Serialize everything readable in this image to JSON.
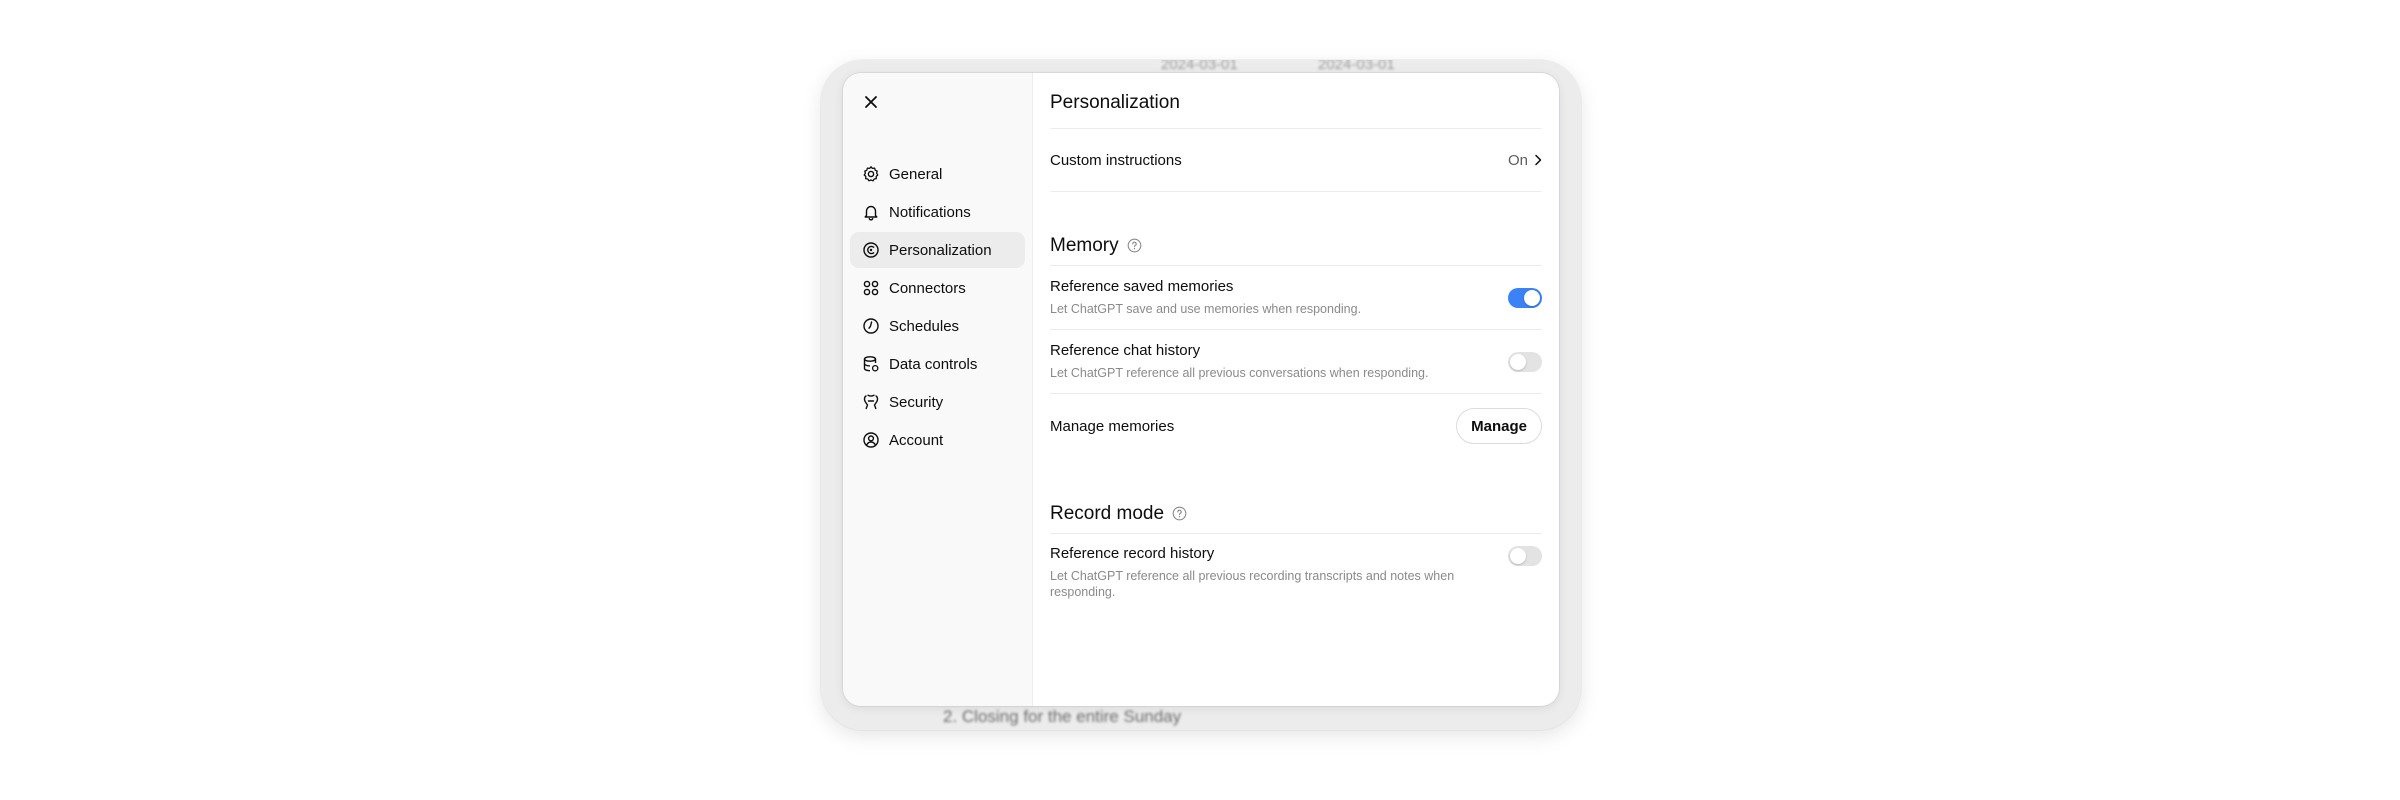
{
  "background": {
    "fragments": [
      "2024-03-01",
      "2024-03-01"
    ],
    "list_item": "2.  Closing for the entire Sunday"
  },
  "dialog": {
    "close_icon": "close-icon",
    "sidebar": {
      "items": [
        {
          "label": "General",
          "icon": "gear-icon"
        },
        {
          "label": "Notifications",
          "icon": "bell-icon"
        },
        {
          "label": "Personalization",
          "icon": "personalization-icon",
          "active": true
        },
        {
          "label": "Connectors",
          "icon": "connectors-icon"
        },
        {
          "label": "Schedules",
          "icon": "clock-icon"
        },
        {
          "label": "Data controls",
          "icon": "database-icon"
        },
        {
          "label": "Security",
          "icon": "shield-icon"
        },
        {
          "label": "Account",
          "icon": "user-circle-icon"
        }
      ]
    },
    "content": {
      "title": "Personalization",
      "custom_instructions": {
        "label": "Custom instructions",
        "value": "On"
      },
      "memory": {
        "title": "Memory",
        "saved_memories": {
          "label": "Reference saved memories",
          "desc": "Let ChatGPT save and use memories when responding.",
          "enabled": true
        },
        "chat_history": {
          "label": "Reference chat history",
          "desc": "Let ChatGPT reference all previous conversations when responding.",
          "enabled": false
        },
        "manage": {
          "label": "Manage memories",
          "button": "Manage"
        }
      },
      "record_mode": {
        "title": "Record mode",
        "record_history": {
          "label": "Reference record history",
          "desc": "Let ChatGPT reference all previous recording transcripts and notes when responding.",
          "enabled": false
        }
      }
    }
  },
  "colors": {
    "toggle_on": "#3b82f6",
    "toggle_off": "#e3e3e3",
    "sidebar_bg": "#f9f9f9",
    "active_item_bg": "#ececec"
  }
}
